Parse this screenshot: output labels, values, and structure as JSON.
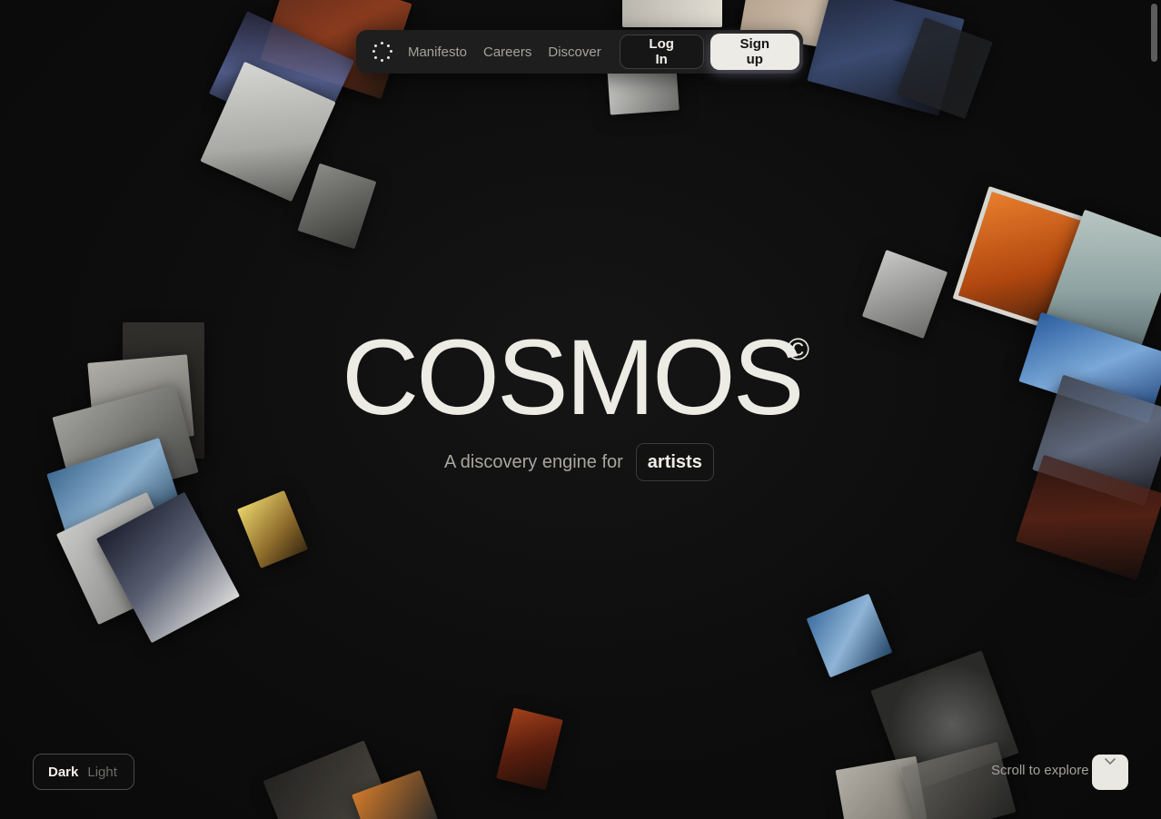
{
  "nav": {
    "logo_icon": "sparkle-dots-icon",
    "links": [
      {
        "label": "Manifesto"
      },
      {
        "label": "Careers"
      },
      {
        "label": "Discover"
      }
    ],
    "login_label": "Log In",
    "signup_label": "Sign up"
  },
  "hero": {
    "title": "COSMOS",
    "mark": "©",
    "tagline": "A discovery engine for",
    "tagline_highlight": "artists"
  },
  "theme_toggle": {
    "dark_label": "Dark",
    "light_label": "Light",
    "selected": "Dark"
  },
  "scroll_hint": {
    "label": "Scroll to explore",
    "icon": "chevron-down-icon"
  },
  "colors": {
    "background": "#0c0c0c",
    "text": "#ecebe4",
    "muted": "#a4a29c",
    "accent_button": "#ecebe5"
  }
}
